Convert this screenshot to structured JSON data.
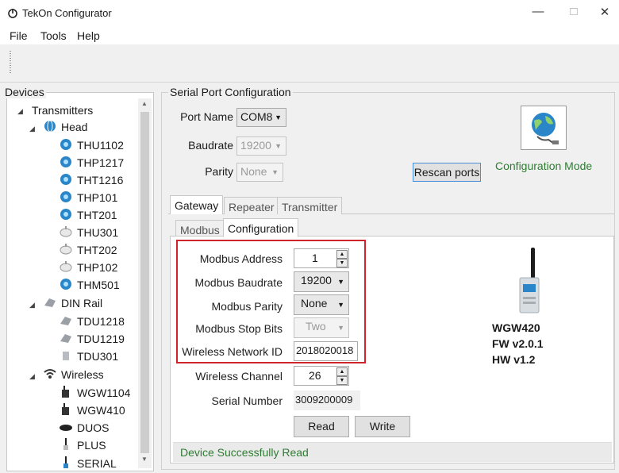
{
  "window": {
    "title": "TekOn Configurator"
  },
  "menu": [
    "File",
    "Tools",
    "Help"
  ],
  "devices": {
    "title": "Devices",
    "tree": [
      {
        "label": "Transmitters",
        "icon": "folder-icon"
      },
      {
        "label": "Head",
        "icon": "globe-icon"
      },
      {
        "label": "THU1102",
        "icon": "sensor-icon"
      },
      {
        "label": "THP1217",
        "icon": "sensor-icon"
      },
      {
        "label": "THT1216",
        "icon": "sensor-icon"
      },
      {
        "label": "THP101",
        "icon": "sensor-icon"
      },
      {
        "label": "THT201",
        "icon": "sensor-icon"
      },
      {
        "label": "THU301",
        "icon": "sensor-icon"
      },
      {
        "label": "THT202",
        "icon": "sensor-icon"
      },
      {
        "label": "THP102",
        "icon": "sensor-icon"
      },
      {
        "label": "THM501",
        "icon": "sensor-icon"
      },
      {
        "label": "DIN Rail",
        "icon": "din-rail-icon"
      },
      {
        "label": "TDU1218",
        "icon": "din-rail-icon"
      },
      {
        "label": "TDU1219",
        "icon": "din-rail-icon"
      },
      {
        "label": "TDU301",
        "icon": "din-rail-icon"
      },
      {
        "label": "Wireless",
        "icon": "wifi-icon"
      },
      {
        "label": "WGW1104",
        "icon": "gateway-icon"
      },
      {
        "label": "WGW410",
        "icon": "gateway-icon"
      },
      {
        "label": "DUOS",
        "icon": "duos-icon"
      },
      {
        "label": "PLUS",
        "icon": "antenna-icon"
      },
      {
        "label": "SERIAL",
        "icon": "antenna-icon"
      }
    ]
  },
  "serial": {
    "title": "Serial Port Configuration",
    "port_name_label": "Port Name",
    "port_name_value": "COM8",
    "baudrate_label": "Baudrate",
    "baudrate_value": "19200",
    "parity_label": "Parity",
    "parity_value": "None",
    "rescan_label": "Rescan ports",
    "config_mode_label": "Configuration Mode"
  },
  "tabs": {
    "top": [
      "Gateway",
      "Repeater",
      "Transmitter"
    ],
    "sub": [
      "Modbus",
      "Configuration"
    ]
  },
  "config": {
    "modbus_address_label": "Modbus Address",
    "modbus_address_value": "1",
    "modbus_baudrate_label": "Modbus Baudrate",
    "modbus_baudrate_value": "19200",
    "modbus_parity_label": "Modbus Parity",
    "modbus_parity_value": "None",
    "modbus_stop_bits_label": "Modbus Stop Bits",
    "modbus_stop_bits_value": "Two",
    "network_id_label": "Wireless Network ID",
    "network_id_value": "2018020018",
    "channel_label": "Wireless Channel",
    "channel_value": "26",
    "serial_number_label": "Serial Number",
    "serial_number_value": "3009200009",
    "read_label": "Read",
    "write_label": "Write"
  },
  "device_info": {
    "model": "WGW420",
    "fw": "FW v2.0.1",
    "hw": "HW v1.2"
  },
  "status": {
    "text": "Device Successfully Read",
    "color": "#2e7d32"
  },
  "colors": {
    "highlight": "#d0242b",
    "accent": "#1a7bd0"
  }
}
